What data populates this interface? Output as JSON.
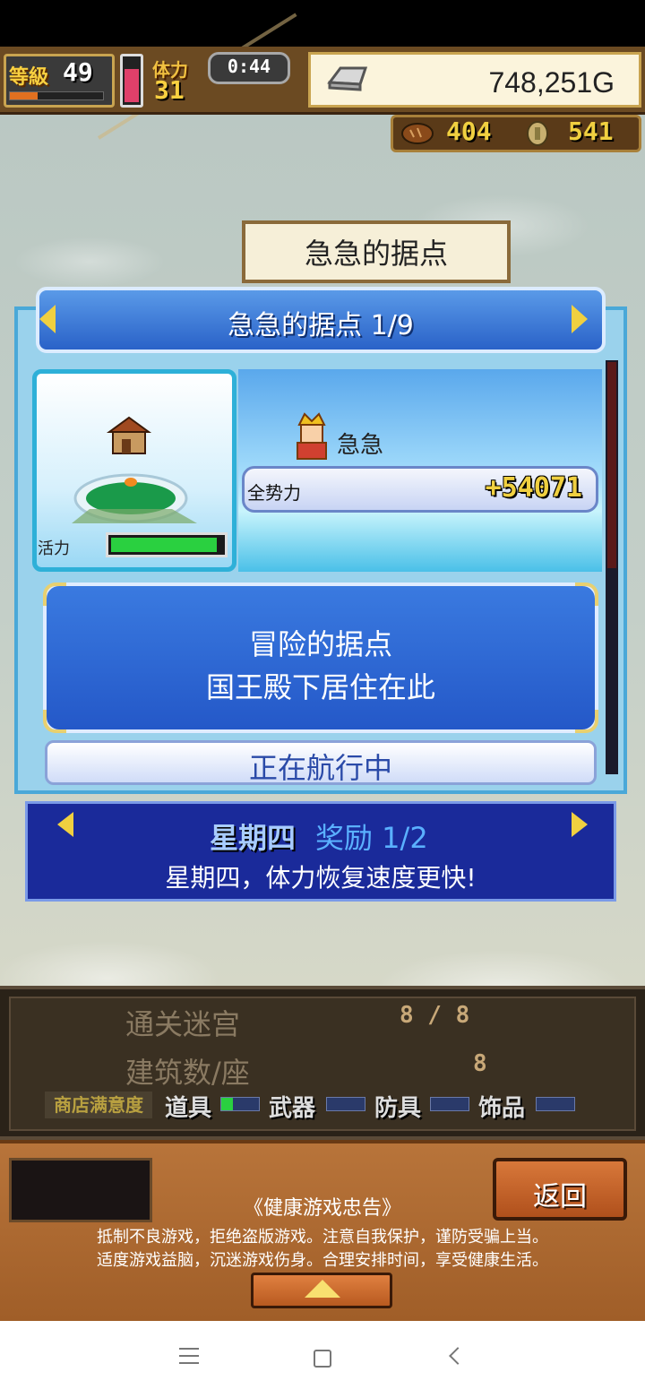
{
  "hud": {
    "level_label": "等級",
    "level_value": "49",
    "level_progress": 0.3,
    "stamina_label": "体力",
    "stamina_value": "31",
    "stamina_fill": 0.8,
    "timer": "0:44",
    "gold": "748,251G",
    "resource1": "404",
    "resource2": "541"
  },
  "sign": {
    "title": "急急的据点"
  },
  "panel": {
    "title": "急急的据点 1/9",
    "owner_name": "急急",
    "power_label": "全势力",
    "power_value": "+54071",
    "vitality_label": "活力",
    "vitality_fill": 0.95,
    "description_line1": "冒险的据点",
    "description_line2": "国王殿下居住在此",
    "status": "正在航行中"
  },
  "bonus": {
    "day": "星期四",
    "title": "奖励 1/2",
    "description": "星期四，体力恢复速度更快!"
  },
  "stats": {
    "dungeon_label": "通关迷宫",
    "dungeon_value": "8 / 8",
    "building_label": "建筑数/座",
    "building_value": "8",
    "satisfaction_label": "商店满意度",
    "categories": [
      {
        "label": "道具",
        "fill": 0.3
      },
      {
        "label": "武器",
        "fill": 0.0
      },
      {
        "label": "防具",
        "fill": 0.0
      },
      {
        "label": "饰品",
        "fill": 0.0
      }
    ]
  },
  "footer": {
    "back_label": "返回",
    "notice_title": "《健康游戏忠告》",
    "notice_line1": "抵制不良游戏，拒绝盗版游戏。注意自我保护，谨防受骗上当。",
    "notice_line2": "适度游戏益脑，沉迷游戏伤身。合理安排时间，享受健康生活。"
  },
  "icons": {
    "gold": "silver-ingot-icon",
    "resource1": "bread-icon",
    "resource2": "coin-icon",
    "owner": "king-portrait-icon",
    "house": "house-icon"
  },
  "colors": {
    "accent_blue": "#2a62c8",
    "gold_text": "#f0d040",
    "vitality_green": "#2ad040"
  }
}
